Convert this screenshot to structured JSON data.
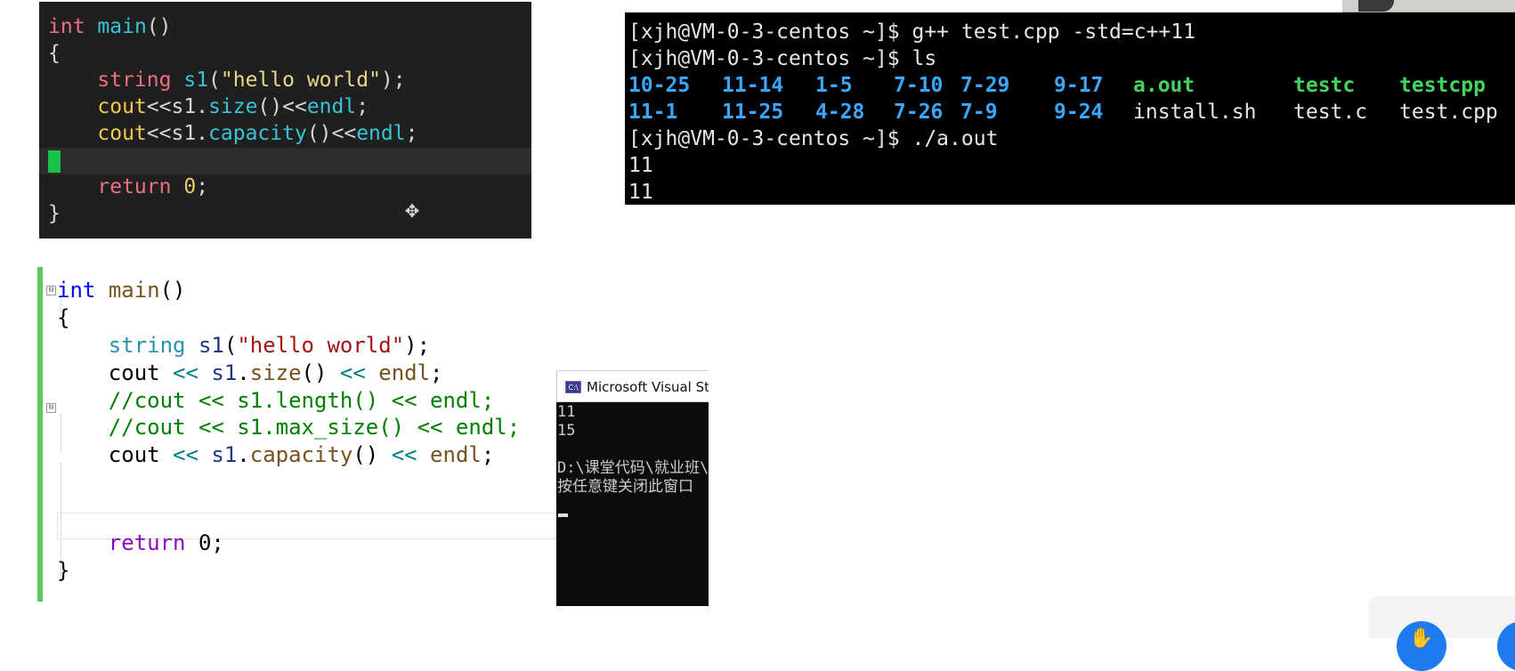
{
  "dark_editor": {
    "line1": {
      "kw": "int",
      "fn": "main",
      "rest": "()"
    },
    "line2": "{",
    "line3": {
      "type": "string",
      "var": "s1",
      "open": "(",
      "str": "\"hello world\"",
      "close": ");"
    },
    "line4": {
      "a": "cout",
      "b": "<<s1.",
      "c": "size",
      "d": "()<<",
      "e": "endl",
      "f": ";"
    },
    "line5": {
      "a": "cout",
      "b": "<<s1.",
      "c": "capacity",
      "d": "()<<",
      "e": "endl",
      "f": ";"
    },
    "line7": {
      "kw": "return",
      "num": "0",
      "end": ";"
    },
    "line8": "}",
    "move_cursor_icon": "move-cursor-icon"
  },
  "terminal": {
    "cmd1": "[xjh@VM-0-3-centos ~]$ g++ test.cpp -std=c++11",
    "cmd2": "[xjh@VM-0-3-centos ~]$ ls",
    "ls_row1": [
      "10-25",
      "11-14",
      "1-5",
      "7-10",
      "7-29",
      "9-17",
      "a.out",
      "testc",
      "testcpp"
    ],
    "ls_row2": [
      "11-1",
      "11-25",
      "4-28",
      "7-26",
      "7-9",
      "9-24",
      "install.sh",
      "test.c",
      "test.cpp"
    ],
    "cmd3": "[xjh@VM-0-3-centos ~]$ ./a.out",
    "out1": "11",
    "out2": "11",
    "colors": {
      "dir": "#3aa7ff",
      "exec": "#43d35f",
      "file": "#e6e6e6"
    }
  },
  "vs_editor": {
    "l1": {
      "kw": "int",
      "fn": "main",
      "rest": "()"
    },
    "l2": "{",
    "l3": {
      "type": "string",
      "var": "s1",
      "open": "(",
      "str": "\"hello world\"",
      "close": ");"
    },
    "l4": {
      "a": "cout",
      "op1": " << ",
      "var": "s1",
      "dot": ".",
      "fn": "size",
      "p": "()",
      "op2": " << ",
      "endl": "endl",
      "semi": ";"
    },
    "l5": "//cout << s1.length() << endl;",
    "l6": "//cout << s1.max_size() << endl;",
    "l7": {
      "a": "cout",
      "op1": " << ",
      "var": "s1",
      "dot": ".",
      "fn": "capacity",
      "p": "()",
      "op2": " << ",
      "endl": "endl",
      "semi": ";"
    },
    "l9": {
      "kw": "return",
      "rest": " 0;"
    },
    "l10": "}",
    "fold_symbol": "⊟"
  },
  "console": {
    "title": "Microsoft Visual Studio 调试控制台",
    "icon_text": "C:\\",
    "lines": [
      "11",
      "15",
      "",
      "D:\\课堂代码\\就业班\\",
      "按任意键关闭此窗口"
    ]
  }
}
